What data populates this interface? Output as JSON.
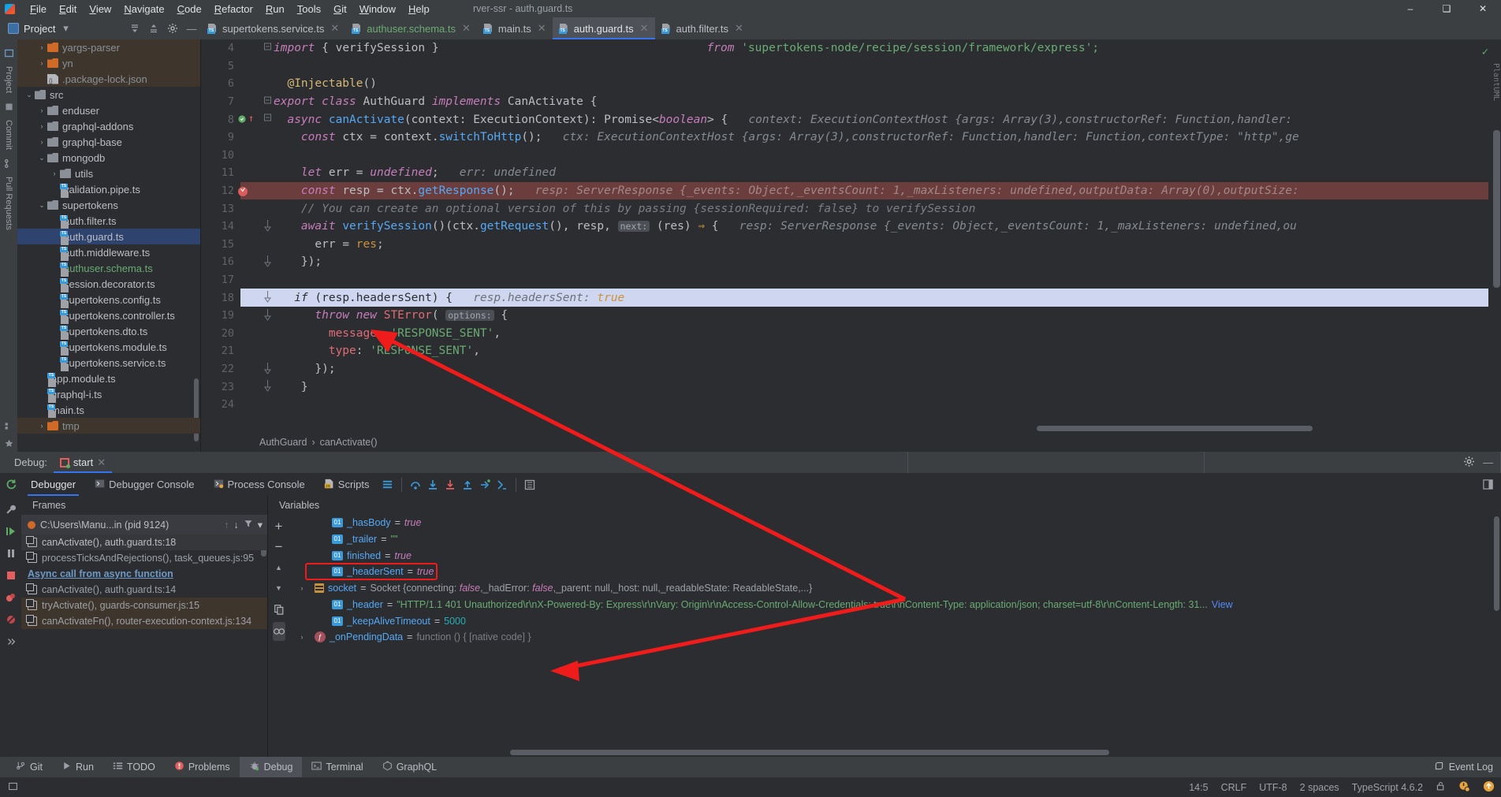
{
  "window": {
    "menu": [
      "File",
      "Edit",
      "View",
      "Navigate",
      "Code",
      "Refactor",
      "Run",
      "Tools",
      "Git",
      "Window",
      "Help"
    ],
    "title_fragment": "rver-ssr  -  auth.guard.ts",
    "minimize": "–",
    "maximize": "❑",
    "close": "✕"
  },
  "project_tool": {
    "title": "Project",
    "chevron": "▾",
    "collapse_icon": "collapse-all-icon",
    "expand_icon": "expand-all-icon",
    "settings_icon": "gear-icon",
    "hide_icon": "—"
  },
  "editor_tabs": [
    {
      "label": "supertokens.service.ts",
      "active": false,
      "color": "normal",
      "close": "✕"
    },
    {
      "label": "authuser.schema.ts",
      "active": false,
      "color": "green",
      "close": "✕"
    },
    {
      "label": "main.ts",
      "active": false,
      "color": "normal",
      "close": "✕"
    },
    {
      "label": "auth.guard.ts",
      "active": true,
      "color": "normal",
      "close": "✕"
    },
    {
      "label": "auth.filter.ts",
      "active": false,
      "color": "normal",
      "close": "✕"
    }
  ],
  "left_rail": [
    "Project",
    "Commit",
    "Pull Requests"
  ],
  "right_rail": [
    "PlantUML"
  ],
  "project_tree": [
    {
      "indent": 1,
      "arrow": "›",
      "kind": "folder-orange",
      "label": "yargs-parser",
      "style": "dim",
      "row": "lib"
    },
    {
      "indent": 1,
      "arrow": "›",
      "kind": "folder-orange",
      "label": "yn",
      "style": "dim",
      "row": "lib"
    },
    {
      "indent": 1,
      "arrow": "",
      "kind": "json",
      "label": ".package-lock.json",
      "style": "dim",
      "row": "lib"
    },
    {
      "indent": 0,
      "arrow": "⌄",
      "kind": "folder",
      "label": "src",
      "style": "",
      "row": ""
    },
    {
      "indent": 1,
      "arrow": "›",
      "kind": "folder",
      "label": "enduser",
      "style": "",
      "row": ""
    },
    {
      "indent": 1,
      "arrow": "›",
      "kind": "folder",
      "label": "graphql-addons",
      "style": "",
      "row": ""
    },
    {
      "indent": 1,
      "arrow": "›",
      "kind": "folder",
      "label": "graphql-base",
      "style": "",
      "row": ""
    },
    {
      "indent": 1,
      "arrow": "⌄",
      "kind": "folder",
      "label": "mongodb",
      "style": "",
      "row": ""
    },
    {
      "indent": 2,
      "arrow": "›",
      "kind": "folder",
      "label": "utils",
      "style": "",
      "row": ""
    },
    {
      "indent": 2,
      "arrow": "",
      "kind": "ts",
      "label": "validation.pipe.ts",
      "style": "",
      "row": ""
    },
    {
      "indent": 1,
      "arrow": "⌄",
      "kind": "folder",
      "label": "supertokens",
      "style": "",
      "row": ""
    },
    {
      "indent": 2,
      "arrow": "",
      "kind": "ts",
      "label": "auth.filter.ts",
      "style": "",
      "row": ""
    },
    {
      "indent": 2,
      "arrow": "",
      "kind": "ts",
      "label": "auth.guard.ts",
      "style": "",
      "row": "sel"
    },
    {
      "indent": 2,
      "arrow": "",
      "kind": "ts",
      "label": "auth.middleware.ts",
      "style": "",
      "row": ""
    },
    {
      "indent": 2,
      "arrow": "",
      "kind": "ts",
      "label": "authuser.schema.ts",
      "style": "green",
      "row": ""
    },
    {
      "indent": 2,
      "arrow": "",
      "kind": "ts",
      "label": "session.decorator.ts",
      "style": "",
      "row": ""
    },
    {
      "indent": 2,
      "arrow": "",
      "kind": "ts",
      "label": "supertokens.config.ts",
      "style": "",
      "row": ""
    },
    {
      "indent": 2,
      "arrow": "",
      "kind": "ts",
      "label": "supertokens.controller.ts",
      "style": "",
      "row": ""
    },
    {
      "indent": 2,
      "arrow": "",
      "kind": "ts",
      "label": "supertokens.dto.ts",
      "style": "",
      "row": ""
    },
    {
      "indent": 2,
      "arrow": "",
      "kind": "ts",
      "label": "supertokens.module.ts",
      "style": "",
      "row": ""
    },
    {
      "indent": 2,
      "arrow": "",
      "kind": "ts",
      "label": "supertokens.service.ts",
      "style": "",
      "row": ""
    },
    {
      "indent": 1,
      "arrow": "",
      "kind": "ts",
      "label": "app.module.ts",
      "style": "",
      "row": ""
    },
    {
      "indent": 1,
      "arrow": "",
      "kind": "ts",
      "label": "graphql-i.ts",
      "style": "",
      "row": ""
    },
    {
      "indent": 1,
      "arrow": "",
      "kind": "ts",
      "label": "main.ts",
      "style": "",
      "row": ""
    },
    {
      "indent": 1,
      "arrow": "›",
      "kind": "folder-orange",
      "label": "tmp",
      "style": "dim",
      "row": "lib"
    }
  ],
  "code": {
    "lines": [
      {
        "n": 4,
        "fold": "minus"
      },
      {
        "n": 5
      },
      {
        "n": 6
      },
      {
        "n": 7,
        "fold": "minus"
      },
      {
        "n": 8,
        "fold": "minus",
        "breakpoint": "green"
      },
      {
        "n": 9
      },
      {
        "n": 10
      },
      {
        "n": 11
      },
      {
        "n": 12,
        "breakpoint": "red-check",
        "highlight": "red"
      },
      {
        "n": 13
      },
      {
        "n": 14,
        "fold": "end"
      },
      {
        "n": 15
      },
      {
        "n": 16,
        "fold": "end"
      },
      {
        "n": 17
      },
      {
        "n": 18,
        "fold": "end",
        "highlight": "blue"
      },
      {
        "n": 19,
        "fold": "end"
      },
      {
        "n": 20
      },
      {
        "n": 21
      },
      {
        "n": 22,
        "fold": "end"
      },
      {
        "n": 23,
        "fold": "end"
      },
      {
        "n": 24
      }
    ],
    "hint_line8": "context: ExecutionContextHost {args: Array(3),constructorRef: Function,handler:",
    "hint_line9_prefix": "ctx: ExecutionContextHost {args: Array(3),constructorRef: Function,handler: Function,contextType: \"http\",ge",
    "hint_line11": "err: undefined",
    "hint_line12": "resp: ServerResponse {_events: Object,_eventsCount: 1,_maxListeners: undefined,outputData: Array(0),outputSize:",
    "hint_line14": "resp: ServerResponse {_events: Object,_eventsCount: 1,_maxListeners: undefined,ou",
    "hint_line18_name": "resp.headersSent:",
    "hint_line18_value": "true",
    "import_from": "from",
    "import_path": "'supertokens-node/recipe/session/framework/express';",
    "comment13": "// You can create an optional version of this by passing {sessionRequired: false} to verifySession",
    "next_hint": "next:",
    "options_hint": "options:"
  },
  "breadcrumbs": {
    "class": "AuthGuard",
    "sep": "›",
    "method": "canActivate()"
  },
  "debug": {
    "label": "Debug:",
    "config_name": "start",
    "close": "✕",
    "settings_icon": "gear-icon",
    "hide_icon": "—",
    "tabs": [
      {
        "label": "Debugger",
        "active": true,
        "icon": ""
      },
      {
        "label": "Debugger Console",
        "active": false,
        "icon": "console-icon"
      },
      {
        "label": "Process Console",
        "active": false,
        "icon": "process-console-icon"
      },
      {
        "label": "Scripts",
        "active": false,
        "icon": "js-icon"
      }
    ],
    "toolbar_icons": [
      "layout-icon",
      "step-over-icon",
      "step-into-icon",
      "force-step-into-icon",
      "step-out-icon",
      "run-to-cursor-icon",
      "evaluate-icon",
      "mute-breakpoints-icon"
    ],
    "frames_header": "Frames",
    "thread_label": "C:\\Users\\Manu...in (pid 9124)",
    "thread_icons": [
      "arrow-up-icon",
      "arrow-down-icon",
      "filter-icon",
      "chevron-down-icon"
    ],
    "frames": [
      {
        "label": "canActivate(), auth.guard.ts:18",
        "row": "sel"
      },
      {
        "label": "processTicksAndRejections(), task_queues.js:95",
        "row": ""
      },
      {
        "label": "Async call from async function",
        "row": "async"
      },
      {
        "label": "canActivate(), auth.guard.ts:14",
        "row": ""
      },
      {
        "label": "tryActivate(), guards-consumer.js:15",
        "row": "lib"
      },
      {
        "label": "canActivateFn(), router-execution-context.js:134",
        "row": "lib"
      }
    ],
    "variables_header": "Variables",
    "vars_toolbar": [
      "+",
      "−",
      "▲",
      "▼",
      "copy-icon",
      "watches-icon"
    ],
    "variables": [
      {
        "exp": "",
        "badge": "01",
        "name": "_hasBody",
        "eq": "=",
        "value": "true",
        "vtype": "bool"
      },
      {
        "exp": "",
        "badge": "01",
        "name": "_trailer",
        "eq": "=",
        "value": "\"\"",
        "vtype": "str"
      },
      {
        "exp": "",
        "badge": "01",
        "name": "finished",
        "eq": "=",
        "value": "true",
        "vtype": "bool"
      },
      {
        "exp": "",
        "badge": "01",
        "name": "_headerSent",
        "eq": "=",
        "value": "true",
        "vtype": "bool",
        "highlighted": true
      },
      {
        "exp": "›",
        "badge": "obj",
        "name": "socket",
        "eq": "=",
        "value": "Socket {connecting: false,_hadError: false,_parent: null,_host: null,_readableState: ReadableState,...}",
        "vtype": "obj"
      },
      {
        "exp": "",
        "badge": "01",
        "name": "_header",
        "eq": "=",
        "value": "\"HTTP/1.1 401 Unauthorized\\r\\nX-Powered-By: Express\\r\\nVary: Origin\\r\\nAccess-Control-Allow-Credentials: true\\r\\nContent-Type: application/json; charset=utf-8\\r\\nContent-Length: 31...",
        "vtype": "str",
        "link": "View"
      },
      {
        "exp": "",
        "badge": "01",
        "name": "_keepAliveTimeout",
        "eq": "=",
        "value": "5000",
        "vtype": "num"
      },
      {
        "exp": "›",
        "badge": "fn",
        "name": "_onPendingData",
        "eq": "=",
        "value": "function () { [native code] }",
        "vtype": "gray"
      }
    ]
  },
  "toolstrip": {
    "items": [
      {
        "label": "Git",
        "icon": "git-icon",
        "active": false
      },
      {
        "label": "Run",
        "icon": "run-icon",
        "active": false
      },
      {
        "label": "TODO",
        "icon": "todo-icon",
        "active": false
      },
      {
        "label": "Problems",
        "icon": "problems-icon",
        "active": false
      },
      {
        "label": "Debug",
        "icon": "debug-icon",
        "active": true
      },
      {
        "label": "Terminal",
        "icon": "terminal-icon",
        "active": false
      },
      {
        "label": "GraphQL",
        "icon": "graphql-icon",
        "active": false
      }
    ],
    "event_log": "Event Log",
    "event_log_icon": "event-log-icon"
  },
  "statusbar": {
    "caret": "14:5",
    "line_sep": "CRLF",
    "encoding": "UTF-8",
    "indent": "2 spaces",
    "language": "TypeScript 4.6.2",
    "lock_icon": "unlocked-icon",
    "inspection_icon": "inspections-icon",
    "update_icon": "update-arrow-icon"
  },
  "colors": {
    "accent_blue": "#3574f0",
    "annotation_red": "#f01b1b",
    "breakpoint_red": "#db5c5c",
    "error_line": "#6b3d3d",
    "selected_line": "#ced6f0",
    "bg": "#2b2d30",
    "panel": "#3c3f41"
  }
}
